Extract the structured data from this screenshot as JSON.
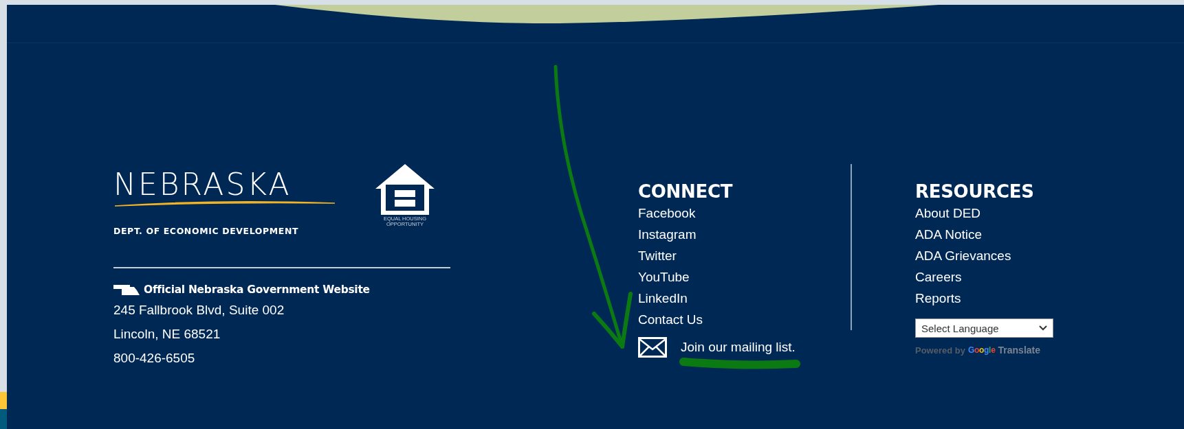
{
  "logo": {
    "wordmark": "NEBRASKA",
    "subtitle": "DEPT. OF ECONOMIC DEVELOPMENT"
  },
  "equal_housing": {
    "line_1": "EQUAL HOUSING",
    "line_2": "OPPORTUNITY"
  },
  "official": "Official Nebraska Government Website",
  "address": [
    "245 Fallbrook Blvd, Suite 002",
    "Lincoln, NE 68521",
    "800-426-6505"
  ],
  "connect": {
    "heading": "CONNECT",
    "links": [
      "Facebook",
      "Instagram",
      "Twitter",
      "YouTube",
      "LinkedIn",
      "Contact Us"
    ],
    "mailing": "Join our mailing list."
  },
  "resources": {
    "heading": "RESOURCES",
    "links": [
      "About DED",
      "ADA Notice",
      "ADA Grievances",
      "Careers",
      "Reports"
    ]
  },
  "language_select": {
    "value": "Select Language"
  },
  "powered_by": {
    "prefix": "Powered by",
    "brand": "Google",
    "suffix": "Translate"
  }
}
